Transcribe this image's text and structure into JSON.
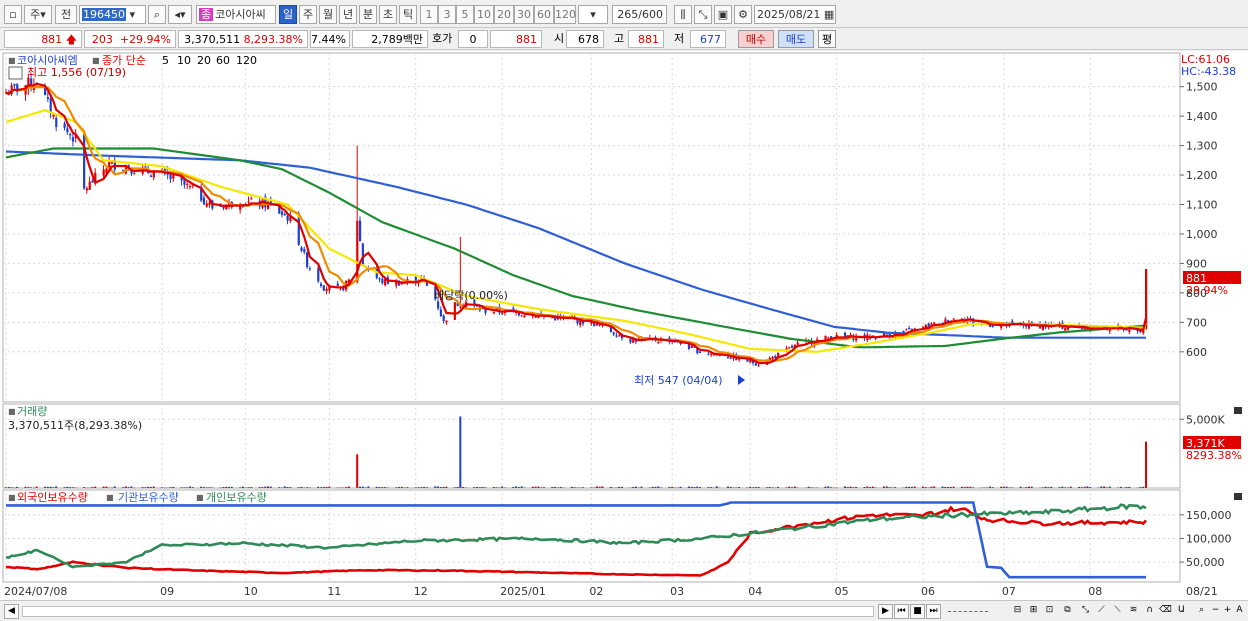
{
  "toolbar": {
    "period_label": "주",
    "prev_label": "전",
    "code": "196450",
    "stock_type_badge": "종",
    "stock_name": "코아시아씨",
    "period_buttons": [
      "일",
      "주",
      "월",
      "년",
      "분",
      "초",
      "틱"
    ],
    "active_period": "일",
    "number_buttons": [
      "1",
      "3",
      "5",
      "10",
      "20",
      "30",
      "60",
      "120"
    ],
    "count_value": "265",
    "count_total": "/600",
    "date_value": "2025/08/21"
  },
  "quote": {
    "price": "881",
    "change": "203",
    "change_pct": "+29.94%",
    "volume": "3,370,511",
    "volume_ratio": "8,293.38%",
    "turnover_pct": "7.44%",
    "amount": "2,789백만",
    "hoga_label": "호가",
    "hoga_value": "0",
    "hoga_price": "881",
    "open_label": "시",
    "open_value": "678",
    "high_label": "고",
    "high_value": "881",
    "low_label": "저",
    "low_value": "677",
    "buy_label": "매수",
    "sell_label": "매도",
    "eval_label": "평"
  },
  "colors": {
    "up": "#e00000",
    "down": "#1d3fd0",
    "ma5": "#e00000",
    "ma10": "#f08c00",
    "ma20": "#f5e800",
    "ma60": "#1e8c32",
    "ma120": "#2f5fd8",
    "foreign": "#e00000",
    "institution": "#2f5fd8",
    "individual": "#2e8b57"
  },
  "chart_data": [
    {
      "type": "candlestick",
      "title": "코아시아씨엠",
      "legend_prefix": "종가 단순",
      "legend": [
        {
          "name": "5",
          "color": "#e00000"
        },
        {
          "name": "10",
          "color": "#f08c00"
        },
        {
          "name": "20",
          "color": "#f5e800"
        },
        {
          "name": "60",
          "color": "#1e8c32"
        },
        {
          "name": "120",
          "color": "#2f5fd8"
        }
      ],
      "annotation_high": "최고 1,556 (07/19)",
      "annotation_low": "최저 547 (04/04)",
      "annotation_dividend": "배당락(0.00%)",
      "lc_label": "LC:61.06",
      "hc_label": "HC:-43.38",
      "current_price_label": "881",
      "current_change_label": "29.94%",
      "ylim": [
        450,
        1560
      ],
      "yticks": [
        600,
        700,
        800,
        900,
        1000,
        1100,
        1200,
        1300,
        1400,
        1500
      ],
      "ytick_labels": [
        "600",
        "700",
        "800",
        "900",
        "1,000",
        "1,100",
        "1,200",
        "1,300",
        "1,400",
        "1,500"
      ],
      "x_ticks": [
        "2024/07/08",
        "09",
        "10",
        "11",
        "12",
        "2025/01",
        "02",
        "03",
        "04",
        "05",
        "06",
        "07",
        "08",
        "08/21"
      ],
      "x_tick_dates": [
        "2024-07-08",
        "2024-09-02",
        "2024-10-02",
        "2024-11-01",
        "2024-12-02",
        "2025-01-02",
        "2025-02-03",
        "2025-03-04",
        "2025-04-01",
        "2025-05-02",
        "2025-06-02",
        "2025-07-01",
        "2025-08-01",
        "2025-08-21"
      ],
      "close_anchors": [
        [
          "2024-07-08",
          1480
        ],
        [
          "2024-07-19",
          1520
        ],
        [
          "2024-07-26",
          1380
        ],
        [
          "2024-08-02",
          1320
        ],
        [
          "2024-08-05",
          1150
        ],
        [
          "2024-08-08",
          1180
        ],
        [
          "2024-08-14",
          1240
        ],
        [
          "2024-08-23",
          1220
        ],
        [
          "2024-09-03",
          1200
        ],
        [
          "2024-09-13",
          1150
        ],
        [
          "2024-09-20",
          1090
        ],
        [
          "2024-09-30",
          1110
        ],
        [
          "2024-10-10",
          1100
        ],
        [
          "2024-10-18",
          1050
        ],
        [
          "2024-10-24",
          900
        ],
        [
          "2024-10-30",
          820
        ],
        [
          "2024-11-05",
          810
        ],
        [
          "2024-11-08",
          840
        ],
        [
          "2024-11-11",
          1050
        ],
        [
          "2024-11-13",
          900
        ],
        [
          "2024-11-19",
          840
        ],
        [
          "2024-11-27",
          835
        ],
        [
          "2024-12-04",
          850
        ],
        [
          "2024-12-09",
          780
        ],
        [
          "2024-12-12",
          700
        ],
        [
          "2024-12-16",
          760
        ],
        [
          "2024-12-20",
          770
        ],
        [
          "2024-12-26",
          740
        ],
        [
          "2025-01-06",
          735
        ],
        [
          "2025-01-17",
          720
        ],
        [
          "2025-02-03",
          700
        ],
        [
          "2025-02-17",
          640
        ],
        [
          "2025-03-04",
          640
        ],
        [
          "2025-03-14",
          600
        ],
        [
          "2025-03-24",
          585
        ],
        [
          "2025-04-04",
          560
        ],
        [
          "2025-04-11",
          590
        ],
        [
          "2025-04-18",
          625
        ],
        [
          "2025-04-30",
          650
        ],
        [
          "2025-05-14",
          650
        ],
        [
          "2025-05-26",
          665
        ],
        [
          "2025-06-05",
          690
        ],
        [
          "2025-06-16",
          720
        ],
        [
          "2025-06-20",
          700
        ],
        [
          "2025-06-30",
          690
        ],
        [
          "2025-07-10",
          690
        ],
        [
          "2025-07-25",
          685
        ],
        [
          "2025-08-06",
          680
        ],
        [
          "2025-08-14",
          680
        ],
        [
          "2025-08-20",
          678
        ],
        [
          "2025-08-21",
          881
        ]
      ],
      "ma_anchors": {
        "ma20": [
          [
            "2024-07-08",
            1380
          ],
          [
            "2024-07-22",
            1420
          ],
          [
            "2024-08-02",
            1380
          ],
          [
            "2024-08-12",
            1250
          ],
          [
            "2024-09-02",
            1230
          ],
          [
            "2024-09-23",
            1160
          ],
          [
            "2024-10-17",
            1100
          ],
          [
            "2024-11-01",
            950
          ],
          [
            "2024-11-18",
            870
          ],
          [
            "2024-12-02",
            860
          ],
          [
            "2024-12-20",
            790
          ],
          [
            "2025-01-15",
            745
          ],
          [
            "2025-02-15",
            705
          ],
          [
            "2025-03-10",
            660
          ],
          [
            "2025-04-01",
            610
          ],
          [
            "2025-04-25",
            600
          ],
          [
            "2025-05-15",
            630
          ],
          [
            "2025-06-05",
            665
          ],
          [
            "2025-06-20",
            695
          ],
          [
            "2025-07-10",
            695
          ],
          [
            "2025-08-20",
            682
          ]
        ],
        "ma60": [
          [
            "2024-07-08",
            1260
          ],
          [
            "2024-07-25",
            1290
          ],
          [
            "2024-08-30",
            1290
          ],
          [
            "2024-09-30",
            1250
          ],
          [
            "2024-10-15",
            1220
          ],
          [
            "2024-11-01",
            1140
          ],
          [
            "2024-11-20",
            1040
          ],
          [
            "2024-12-16",
            950
          ],
          [
            "2025-01-06",
            860
          ],
          [
            "2025-01-27",
            790
          ],
          [
            "2025-02-20",
            740
          ],
          [
            "2025-03-20",
            690
          ],
          [
            "2025-04-15",
            645
          ],
          [
            "2025-05-10",
            615
          ],
          [
            "2025-06-10",
            620
          ],
          [
            "2025-07-01",
            645
          ],
          [
            "2025-07-20",
            665
          ],
          [
            "2025-08-20",
            688
          ]
        ],
        "ma120": [
          [
            "2024-07-08",
            1280
          ],
          [
            "2024-08-15",
            1265
          ],
          [
            "2024-09-30",
            1250
          ],
          [
            "2024-10-25",
            1225
          ],
          [
            "2024-11-25",
            1160
          ],
          [
            "2024-12-20",
            1100
          ],
          [
            "2025-01-15",
            1020
          ],
          [
            "2025-02-15",
            900
          ],
          [
            "2025-03-15",
            810
          ],
          [
            "2025-04-10",
            740
          ],
          [
            "2025-05-01",
            685
          ],
          [
            "2025-05-20",
            665
          ],
          [
            "2025-06-15",
            655
          ],
          [
            "2025-07-01",
            648
          ],
          [
            "2025-08-20",
            648
          ]
        ]
      }
    },
    {
      "type": "bar",
      "title": "거래량",
      "summary": "3,370,511주(8,293.38%)",
      "current_label": "3,371K",
      "current_pct_label": "8293.38%",
      "ylim": [
        0,
        5600
      ],
      "yticks": [
        5000
      ],
      "ytick_labels": [
        "5,000K"
      ],
      "spikes": [
        [
          "2024-11-11",
          2450
        ],
        [
          "2024-12-18",
          5200
        ],
        [
          "2025-08-21",
          3371
        ]
      ],
      "baseline_volume": 80
    },
    {
      "type": "line",
      "legend": [
        {
          "name": "외국인보유수량",
          "color": "#e00000"
        },
        {
          "name": "기관보유수량",
          "color": "#2f5fd8"
        },
        {
          "name": "개인보유수량",
          "color": "#2e8b57"
        }
      ],
      "ylim": [
        10000,
        175000
      ],
      "yticks": [
        50000,
        100000,
        150000
      ],
      "ytick_labels": [
        "50,000",
        "100,000",
        "150,000"
      ],
      "series": [
        {
          "name": "외국인보유수량",
          "anchors": [
            [
              "2024-07-08",
              40000
            ],
            [
              "2024-07-20",
              35000
            ],
            [
              "2024-08-01",
              50000
            ],
            [
              "2024-08-20",
              38000
            ],
            [
              "2024-09-15",
              32000
            ],
            [
              "2024-10-15",
              27000
            ],
            [
              "2024-11-15",
              33000
            ],
            [
              "2024-12-15",
              32000
            ],
            [
              "2025-01-15",
              28000
            ],
            [
              "2025-02-15",
              24000
            ],
            [
              "2025-03-15",
              22000
            ],
            [
              "2025-03-24",
              50000
            ],
            [
              "2025-04-01",
              110000
            ],
            [
              "2025-04-20",
              130000
            ],
            [
              "2025-05-15",
              150000
            ],
            [
              "2025-06-01",
              148000
            ],
            [
              "2025-06-15",
              165000
            ],
            [
              "2025-06-25",
              140000
            ],
            [
              "2025-07-15",
              132000
            ],
            [
              "2025-08-21",
              135000
            ]
          ]
        },
        {
          "name": "기관보유수량",
          "anchors": [
            [
              "2024-07-08",
              170000
            ],
            [
              "2025-03-22",
              170000
            ],
            [
              "2025-03-25",
              176000
            ],
            [
              "2025-06-20",
              176000
            ],
            [
              "2025-06-25",
              40000
            ],
            [
              "2025-06-30",
              38000
            ],
            [
              "2025-07-03",
              18000
            ],
            [
              "2025-08-21",
              18000
            ]
          ]
        },
        {
          "name": "개인보유수량",
          "anchors": [
            [
              "2024-07-08",
              60000
            ],
            [
              "2024-07-20",
              75000
            ],
            [
              "2024-08-01",
              40000
            ],
            [
              "2024-08-20",
              50000
            ],
            [
              "2024-09-01",
              85000
            ],
            [
              "2024-10-01",
              90000
            ],
            [
              "2024-11-01",
              80000
            ],
            [
              "2024-12-01",
              95000
            ],
            [
              "2025-01-15",
              100000
            ],
            [
              "2025-02-15",
              90000
            ],
            [
              "2025-03-15",
              100000
            ],
            [
              "2025-04-15",
              120000
            ],
            [
              "2025-05-15",
              140000
            ],
            [
              "2025-06-15",
              150000
            ],
            [
              "2025-07-15",
              155000
            ],
            [
              "2025-08-15",
              168000
            ],
            [
              "2025-08-21",
              165000
            ]
          ]
        }
      ]
    }
  ]
}
